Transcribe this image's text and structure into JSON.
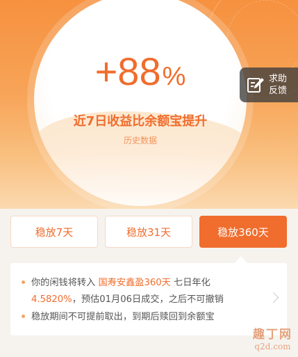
{
  "hero": {
    "percent_value": "+88",
    "percent_symbol": "%",
    "subtitle": "近7日收益比余额宝提升",
    "note": "历史数据"
  },
  "help": {
    "line1": "求助",
    "line2": "反馈",
    "icon": "edit-feedback-icon"
  },
  "tabs": [
    {
      "label": "稳放7天",
      "active": false
    },
    {
      "label": "稳放31天",
      "active": false
    },
    {
      "label": "稳放360天",
      "active": true
    }
  ],
  "info": {
    "line1_prefix": "你的闲钱将转入",
    "line1_product": "国寿安鑫盈360天",
    "line1_suffix": "七日年化",
    "line2_rate": "4.5820%",
    "line2_suffix": "，预估01月06日成交，之后不可撤销",
    "line3": "稳放期间不可提前取出，到期后赎回到余额宝"
  },
  "watermark": {
    "line1": "趣丁网",
    "line2": "q2d.com"
  },
  "colors": {
    "accent": "#f06d2d",
    "hero_gradient_top": "#f6913f",
    "background": "#f6f3ef"
  }
}
